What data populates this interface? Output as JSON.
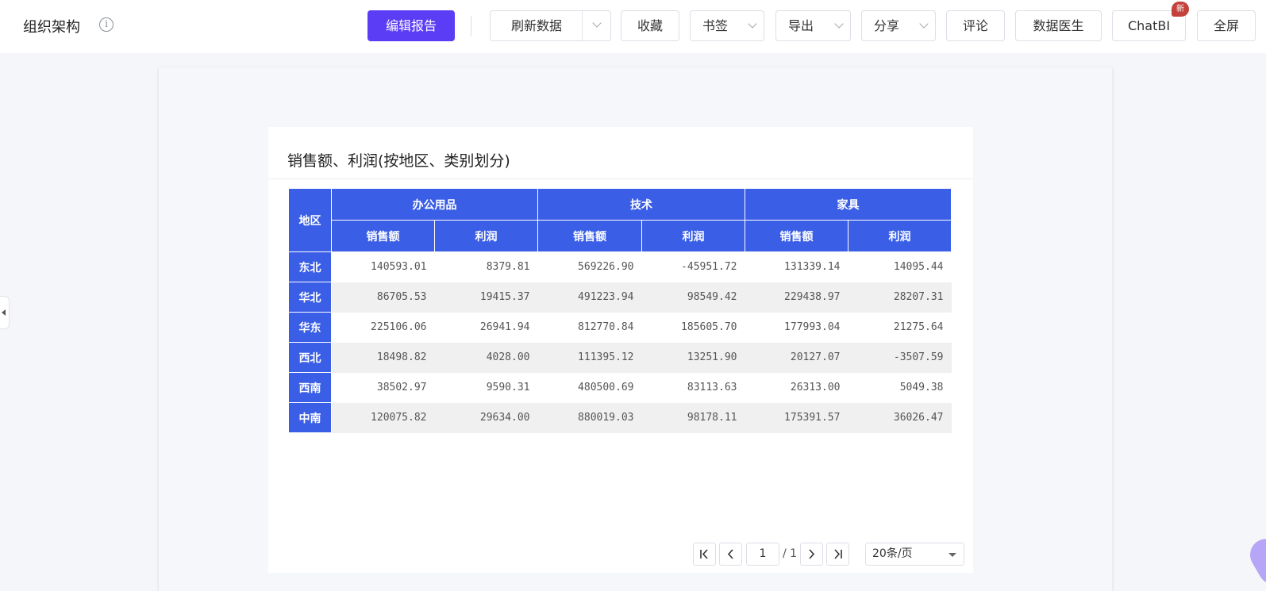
{
  "header": {
    "title": "组织架构",
    "info_icon": "info-icon",
    "edit_report": "编辑报告",
    "refresh": "刷新数据",
    "favorite": "收藏",
    "bookmark": "书签",
    "export": "导出",
    "share": "分享",
    "comment": "评论",
    "data_doctor": "数据医生",
    "chatbi": "ChatBI",
    "chatbi_badge": "新",
    "fullscreen": "全屏"
  },
  "colors": {
    "primary_button": "#5b3df5",
    "table_header": "#3a5ee6",
    "badge": "#c4423b"
  },
  "card": {
    "title": "销售额、利润(按地区、类别划分)"
  },
  "table": {
    "row_header_label": "地区",
    "categories": [
      "办公用品",
      "技术",
      "家具"
    ],
    "measures": [
      "销售额",
      "利润"
    ],
    "rows": [
      {
        "region": "东北",
        "values": [
          "140593.01",
          "8379.81",
          "569226.90",
          "-45951.72",
          "131339.14",
          "14095.44"
        ]
      },
      {
        "region": "华北",
        "values": [
          "86705.53",
          "19415.37",
          "491223.94",
          "98549.42",
          "229438.97",
          "28207.31"
        ]
      },
      {
        "region": "华东",
        "values": [
          "225106.06",
          "26941.94",
          "812770.84",
          "185605.70",
          "177993.04",
          "21275.64"
        ]
      },
      {
        "region": "西北",
        "values": [
          "18498.82",
          "4028.00",
          "111395.12",
          "13251.90",
          "20127.07",
          "-3507.59"
        ]
      },
      {
        "region": "西南",
        "values": [
          "38502.97",
          "9590.31",
          "480500.69",
          "83113.63",
          "26313.00",
          "5049.38"
        ]
      },
      {
        "region": "中南",
        "values": [
          "120075.82",
          "29634.00",
          "880019.03",
          "98178.11",
          "175391.57",
          "36026.47"
        ]
      }
    ]
  },
  "pagination": {
    "current_page": "1",
    "total_pages": "/ 1",
    "page_size": "20条/页"
  }
}
